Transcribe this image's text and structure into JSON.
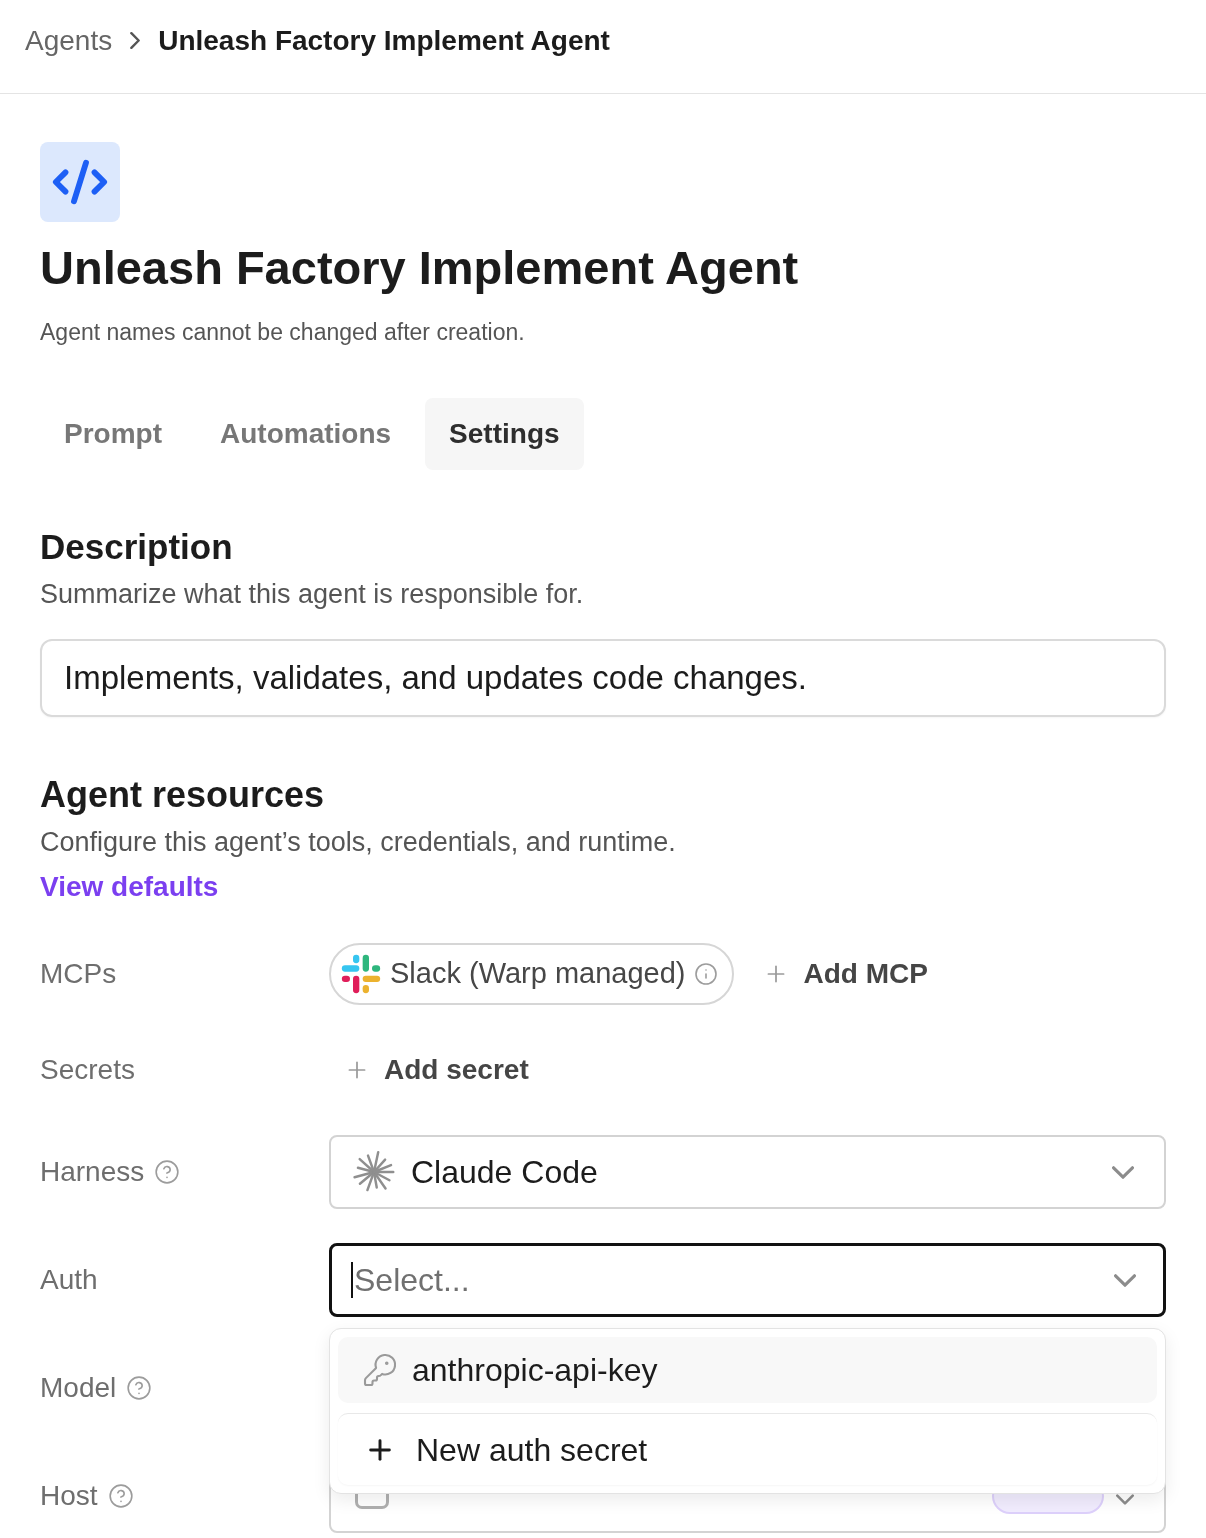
{
  "breadcrumb": [
    {
      "label": "Agents",
      "current": false
    },
    {
      "label": "Unleash Factory Implement Agent",
      "current": true
    }
  ],
  "agent": {
    "title": "Unleash Factory Implement Agent",
    "note": "Agent names cannot be changed after creation."
  },
  "tabs": [
    {
      "label": "Prompt",
      "selected": false
    },
    {
      "label": "Automations",
      "selected": false
    },
    {
      "label": "Settings",
      "selected": true
    }
  ],
  "description": {
    "heading": "Description",
    "subtitle": "Summarize what this agent is responsible for.",
    "value": "Implements, validates, and updates code changes."
  },
  "resources": {
    "heading": "Agent resources",
    "subtitle": "Configure this agent’s tools, credentials, and runtime.",
    "link": "View defaults",
    "rows": [
      {
        "kind": "mcps",
        "label": "MCPs",
        "help": false,
        "chips": [
          {
            "label": "Slack (Warp managed)"
          }
        ],
        "add": "Add MCP"
      },
      {
        "kind": "add",
        "label": "Secrets",
        "help": false,
        "add": "Add secret"
      },
      {
        "kind": "harness",
        "label": "Harness",
        "help": true,
        "value": "Claude Code"
      },
      {
        "kind": "auth",
        "label": "Auth",
        "help": false,
        "placeholder": "Select...",
        "focused": true,
        "expanded": true,
        "options": [
          {
            "kind": "secret",
            "label": "anthropic-api-key",
            "highlighted": true
          },
          {
            "kind": "create",
            "label": "New auth secret",
            "highlighted": false
          }
        ]
      },
      {
        "kind": "covered",
        "label": "Model",
        "help": true
      },
      {
        "kind": "host",
        "label": "Host",
        "help": true
      }
    ]
  }
}
